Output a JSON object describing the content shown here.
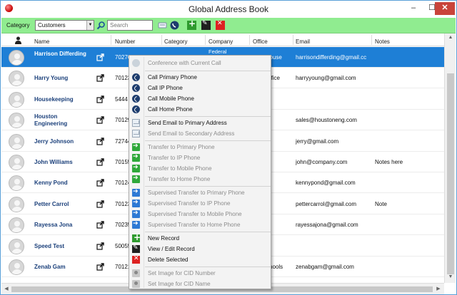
{
  "window": {
    "title": "Global Address Book",
    "min": "–",
    "max": "☐",
    "close": "✕"
  },
  "toolbar": {
    "category_label": "Category",
    "category_value": "Customers",
    "search_placeholder": "Search"
  },
  "columns": {
    "number": "Number",
    "category": "Category",
    "company": "Company",
    "office": "Office",
    "email": "Email",
    "notes": "Notes",
    "name": "Name"
  },
  "rows": [
    {
      "name": "Harrison Differding",
      "number": "70276",
      "company": "Federal",
      "office": "house",
      "email": "harrisondifferding@gmail.cc",
      "notes": "",
      "selected": true
    },
    {
      "name": "Harry Young",
      "number": "70123",
      "company": "",
      "office": "office",
      "email": "harryyoung@gmail.com",
      "notes": ""
    },
    {
      "name": "Housekeeping",
      "number": "5444",
      "company": "",
      "office": "",
      "email": "",
      "notes": ""
    },
    {
      "name": "Houston Engineering",
      "number": "70129",
      "company": "",
      "office": "",
      "email": "sales@houstoneng.com",
      "notes": ""
    },
    {
      "name": "Jerry Johnson",
      "number": "72744",
      "company": "",
      "office": "",
      "email": "jerry@gmail.com",
      "notes": ""
    },
    {
      "name": "John Williams",
      "number": "70155",
      "company": "",
      "office": "",
      "email": "john@company.com",
      "notes": "Notes here"
    },
    {
      "name": "Kenny Pond",
      "number": "70124",
      "company": "",
      "office": "",
      "email": "kennypond@gmail.com",
      "notes": ""
    },
    {
      "name": "Petter Carrol",
      "number": "70123",
      "company": "",
      "office": "",
      "email": "pettercarrol@gmail.com",
      "notes": "Note"
    },
    {
      "name": "Rayessa Jona",
      "number": "70235",
      "company": "",
      "office": "",
      "email": "rayessajona@gmail.com",
      "notes": ""
    },
    {
      "name": "Speed Test",
      "number": "50055",
      "company": "",
      "office": "",
      "email": "",
      "notes": ""
    },
    {
      "name": "Zenab Gam",
      "number": "70121",
      "company": "",
      "office": "chools",
      "email": "zenabgam@gmail.com",
      "notes": ""
    }
  ],
  "menu": {
    "conference": "Conference with Current Call",
    "call_primary": "Call Primary Phone",
    "call_ip": "Call IP Phone",
    "call_mobile": "Call Mobile Phone",
    "call_home": "Call Home Phone",
    "email_primary": "Send Email to Primary Address",
    "email_secondary": "Send Email to Secondary Address",
    "transfer_primary": "Transfer to Primary Phone",
    "transfer_ip": "Transfer to IP Phone",
    "transfer_mobile": "Transfer to Mobile Phone",
    "transfer_home": "Transfer to Home Phone",
    "sup_primary": "Supervised Transfer to Primary Phone",
    "sup_ip": "Supervised Transfer to IP Phone",
    "sup_mobile": "Supervised Transfer to Mobile Phone",
    "sup_home": "Supervised Transfer to Home Phone",
    "new_record": "New Record",
    "view_edit": "View / Edit Record",
    "delete_selected": "Delete Selected",
    "image_cid_number": "Set Image for CID Number",
    "image_cid_name": "Set Image for CID Name"
  },
  "colors": {
    "toolbar_bg": "#90ec90",
    "selected_row": "#1e7fd6",
    "name_text": "#1a3f7a"
  }
}
